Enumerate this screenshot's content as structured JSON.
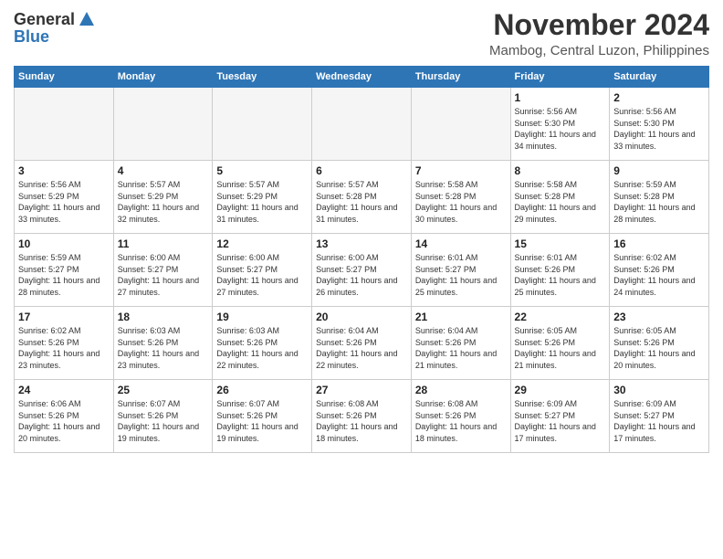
{
  "logo": {
    "general": "General",
    "blue": "Blue"
  },
  "header": {
    "month": "November 2024",
    "location": "Mambog, Central Luzon, Philippines"
  },
  "weekdays": [
    "Sunday",
    "Monday",
    "Tuesday",
    "Wednesday",
    "Thursday",
    "Friday",
    "Saturday"
  ],
  "weeks": [
    [
      {
        "day": "",
        "info": ""
      },
      {
        "day": "",
        "info": ""
      },
      {
        "day": "",
        "info": ""
      },
      {
        "day": "",
        "info": ""
      },
      {
        "day": "",
        "info": ""
      },
      {
        "day": "1",
        "info": "Sunrise: 5:56 AM\nSunset: 5:30 PM\nDaylight: 11 hours and 34 minutes."
      },
      {
        "day": "2",
        "info": "Sunrise: 5:56 AM\nSunset: 5:30 PM\nDaylight: 11 hours and 33 minutes."
      }
    ],
    [
      {
        "day": "3",
        "info": "Sunrise: 5:56 AM\nSunset: 5:29 PM\nDaylight: 11 hours and 33 minutes."
      },
      {
        "day": "4",
        "info": "Sunrise: 5:57 AM\nSunset: 5:29 PM\nDaylight: 11 hours and 32 minutes."
      },
      {
        "day": "5",
        "info": "Sunrise: 5:57 AM\nSunset: 5:29 PM\nDaylight: 11 hours and 31 minutes."
      },
      {
        "day": "6",
        "info": "Sunrise: 5:57 AM\nSunset: 5:28 PM\nDaylight: 11 hours and 31 minutes."
      },
      {
        "day": "7",
        "info": "Sunrise: 5:58 AM\nSunset: 5:28 PM\nDaylight: 11 hours and 30 minutes."
      },
      {
        "day": "8",
        "info": "Sunrise: 5:58 AM\nSunset: 5:28 PM\nDaylight: 11 hours and 29 minutes."
      },
      {
        "day": "9",
        "info": "Sunrise: 5:59 AM\nSunset: 5:28 PM\nDaylight: 11 hours and 28 minutes."
      }
    ],
    [
      {
        "day": "10",
        "info": "Sunrise: 5:59 AM\nSunset: 5:27 PM\nDaylight: 11 hours and 28 minutes."
      },
      {
        "day": "11",
        "info": "Sunrise: 6:00 AM\nSunset: 5:27 PM\nDaylight: 11 hours and 27 minutes."
      },
      {
        "day": "12",
        "info": "Sunrise: 6:00 AM\nSunset: 5:27 PM\nDaylight: 11 hours and 27 minutes."
      },
      {
        "day": "13",
        "info": "Sunrise: 6:00 AM\nSunset: 5:27 PM\nDaylight: 11 hours and 26 minutes."
      },
      {
        "day": "14",
        "info": "Sunrise: 6:01 AM\nSunset: 5:27 PM\nDaylight: 11 hours and 25 minutes."
      },
      {
        "day": "15",
        "info": "Sunrise: 6:01 AM\nSunset: 5:26 PM\nDaylight: 11 hours and 25 minutes."
      },
      {
        "day": "16",
        "info": "Sunrise: 6:02 AM\nSunset: 5:26 PM\nDaylight: 11 hours and 24 minutes."
      }
    ],
    [
      {
        "day": "17",
        "info": "Sunrise: 6:02 AM\nSunset: 5:26 PM\nDaylight: 11 hours and 23 minutes."
      },
      {
        "day": "18",
        "info": "Sunrise: 6:03 AM\nSunset: 5:26 PM\nDaylight: 11 hours and 23 minutes."
      },
      {
        "day": "19",
        "info": "Sunrise: 6:03 AM\nSunset: 5:26 PM\nDaylight: 11 hours and 22 minutes."
      },
      {
        "day": "20",
        "info": "Sunrise: 6:04 AM\nSunset: 5:26 PM\nDaylight: 11 hours and 22 minutes."
      },
      {
        "day": "21",
        "info": "Sunrise: 6:04 AM\nSunset: 5:26 PM\nDaylight: 11 hours and 21 minutes."
      },
      {
        "day": "22",
        "info": "Sunrise: 6:05 AM\nSunset: 5:26 PM\nDaylight: 11 hours and 21 minutes."
      },
      {
        "day": "23",
        "info": "Sunrise: 6:05 AM\nSunset: 5:26 PM\nDaylight: 11 hours and 20 minutes."
      }
    ],
    [
      {
        "day": "24",
        "info": "Sunrise: 6:06 AM\nSunset: 5:26 PM\nDaylight: 11 hours and 20 minutes."
      },
      {
        "day": "25",
        "info": "Sunrise: 6:07 AM\nSunset: 5:26 PM\nDaylight: 11 hours and 19 minutes."
      },
      {
        "day": "26",
        "info": "Sunrise: 6:07 AM\nSunset: 5:26 PM\nDaylight: 11 hours and 19 minutes."
      },
      {
        "day": "27",
        "info": "Sunrise: 6:08 AM\nSunset: 5:26 PM\nDaylight: 11 hours and 18 minutes."
      },
      {
        "day": "28",
        "info": "Sunrise: 6:08 AM\nSunset: 5:26 PM\nDaylight: 11 hours and 18 minutes."
      },
      {
        "day": "29",
        "info": "Sunrise: 6:09 AM\nSunset: 5:27 PM\nDaylight: 11 hours and 17 minutes."
      },
      {
        "day": "30",
        "info": "Sunrise: 6:09 AM\nSunset: 5:27 PM\nDaylight: 11 hours and 17 minutes."
      }
    ]
  ]
}
